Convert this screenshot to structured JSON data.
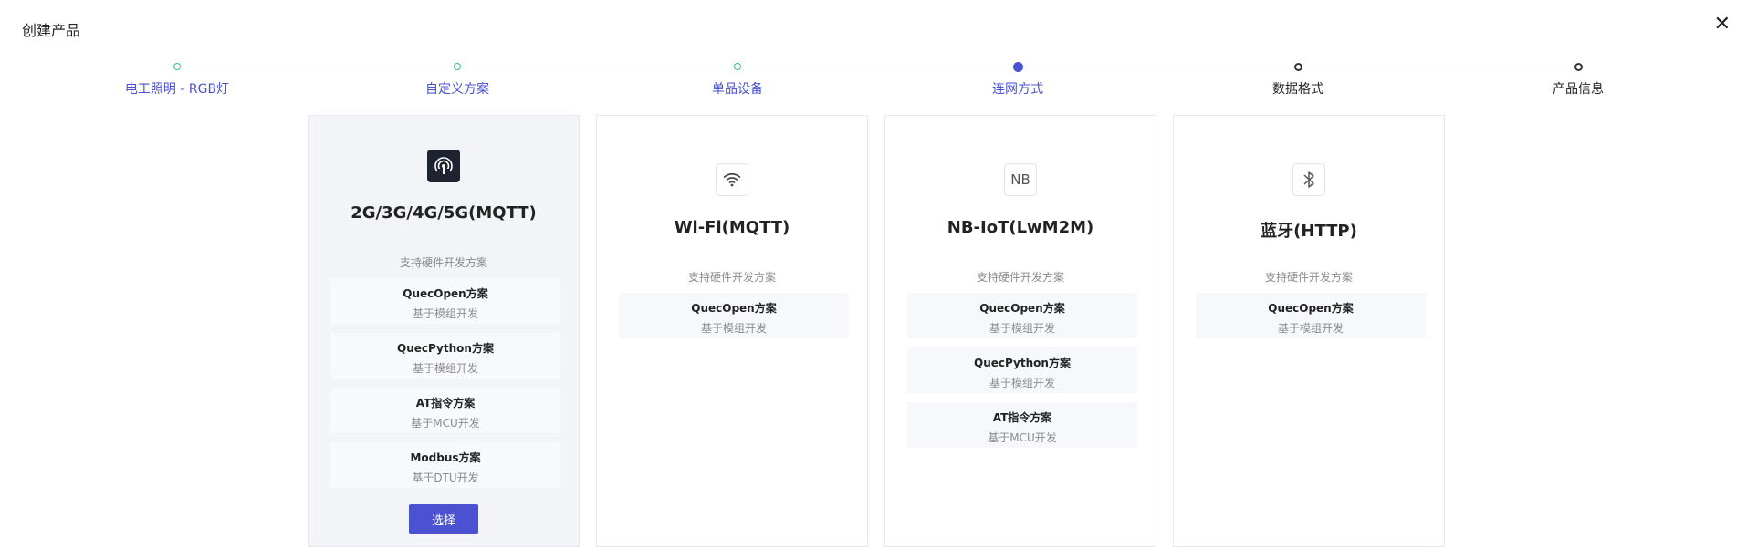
{
  "dialog": {
    "title": "创建产品",
    "close_symbol": "✕"
  },
  "steps": [
    {
      "label": "电工照明 - RGB灯",
      "state": "done"
    },
    {
      "label": "自定义方案",
      "state": "done"
    },
    {
      "label": "单品设备",
      "state": "done"
    },
    {
      "label": "连网方式",
      "state": "current"
    },
    {
      "label": "数据格式",
      "state": "todo"
    },
    {
      "label": "产品信息",
      "state": "todo"
    }
  ],
  "cards": [
    {
      "title": "2G/3G/4G/5G(MQTT)",
      "icon": "cellular-signal-icon",
      "support_label": "支持硬件开发方案",
      "selected": true,
      "options": [
        {
          "name": "QuecOpen方案",
          "desc": "基于模组开发"
        },
        {
          "name": "QuecPython方案",
          "desc": "基于模组开发"
        },
        {
          "name": "AT指令方案",
          "desc": "基于MCU开发"
        },
        {
          "name": "Modbus方案",
          "desc": "基于DTU开发"
        }
      ],
      "select_label": "选择"
    },
    {
      "title": "Wi-Fi(MQTT)",
      "icon": "wifi-icon",
      "support_label": "支持硬件开发方案",
      "options": [
        {
          "name": "QuecOpen方案",
          "desc": "基于模组开发"
        }
      ]
    },
    {
      "title": "NB-IoT(LwM2M)",
      "icon": "nb-icon",
      "icon_text": "NB",
      "support_label": "支持硬件开发方案",
      "options": [
        {
          "name": "QuecOpen方案",
          "desc": "基于模组开发"
        },
        {
          "name": "QuecPython方案",
          "desc": "基于模组开发"
        },
        {
          "name": "AT指令方案",
          "desc": "基于MCU开发"
        }
      ]
    },
    {
      "title": "蓝牙(HTTP)",
      "icon": "bluetooth-icon",
      "support_label": "支持硬件开发方案",
      "options": [
        {
          "name": "QuecOpen方案",
          "desc": "基于模组开发"
        }
      ]
    }
  ],
  "colors": {
    "primary": "#4b52d1",
    "done": "#3bbf8d",
    "selected_card_bg": "#f3f4f7"
  }
}
